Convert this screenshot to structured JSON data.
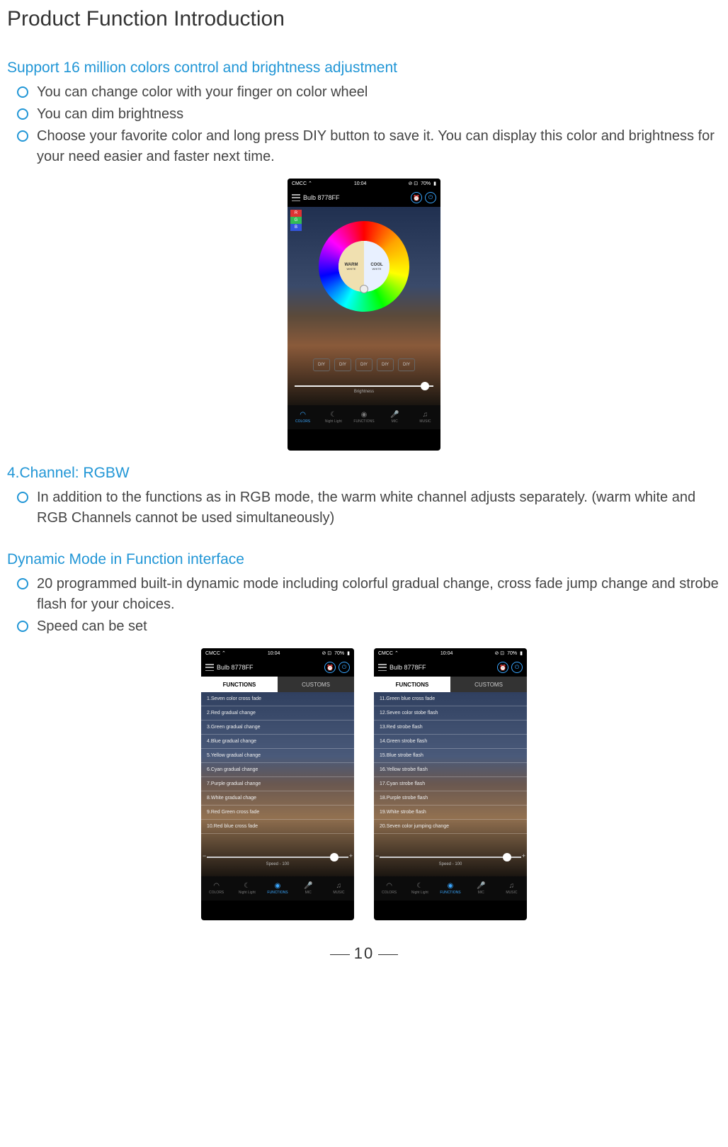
{
  "page_title": "Product Function Introduction",
  "section1": {
    "heading": "Support 16 million colors control and brightness adjustment",
    "bullets": [
      "You can change color with your finger on color wheel",
      "You can dim brightness",
      "Choose your favorite color and long press DIY button to save it. You can display this color and brightness for your need easier and faster next time."
    ]
  },
  "section2": {
    "heading": "4.Channel: RGBW",
    "bullets": [
      "In addition to the functions as in RGB mode, the warm white channel adjusts separately. (warm white and RGB Channels cannot be used simultaneously)"
    ]
  },
  "section3": {
    "heading": "Dynamic Mode in Function interface",
    "bullets": [
      "20 programmed built-in dynamic mode including colorful gradual change, cross fade jump change and strobe flash for your choices.",
      "Speed can be set"
    ]
  },
  "phone": {
    "status": {
      "carrier": "CMCC",
      "time": "10:04",
      "battery": "70%"
    },
    "device": "Bulb 8778FF",
    "rgb_tabs": [
      "R",
      "G",
      "B"
    ],
    "warm_label": "WARM",
    "warm_sub": "WHITE",
    "cool_label": "COOL",
    "cool_sub": "WHITE",
    "diy_label": "DIY",
    "brightness_label": "Brightness",
    "fn_tabs": {
      "functions": "FUNCTIONS",
      "customs": "CUSTOMS"
    },
    "speed_label": "Speed - 100",
    "bottom_tabs": [
      "COLORS",
      "Night Light",
      "FUNCTIONS",
      "MIC",
      "MUSIC"
    ],
    "functions_a": [
      "1.Seven color cross fade",
      "2.Red gradual change",
      "3.Green gradual change",
      "4.Blue gradual change",
      "5.Yellow gradual change",
      "6.Cyan gradual change",
      "7.Purple gradual change",
      "8.White gradual chage",
      "9.Red Green cross fade",
      "10.Red blue cross fade"
    ],
    "functions_b": [
      "11.Green blue cross fade",
      "12.Seven color stobe flash",
      "13.Red strobe flash",
      "14.Green strobe flash",
      "15.Blue strobe flash",
      "16.Yellow strobe flash",
      "17.Cyan strobe flash",
      "18.Purple strobe flash",
      "19.White strobe flash",
      "20.Seven color jumping change"
    ]
  },
  "page_number": "10"
}
